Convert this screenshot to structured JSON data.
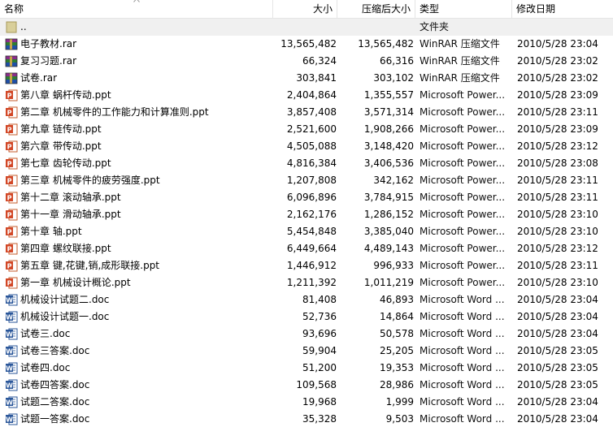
{
  "columns": {
    "name": "名称",
    "size": "大小",
    "packed": "压缩后大小",
    "type": "类型",
    "modified": "修改日期"
  },
  "parent": {
    "name": "..",
    "type": "文件夹"
  },
  "files": [
    {
      "name": "电子教材.rar",
      "size": "13,565,482",
      "packed": "13,565,482",
      "type": "WinRAR 压缩文件",
      "modified": "2010/5/28 23:04",
      "icon": "rar-archive-icon"
    },
    {
      "name": "复习习题.rar",
      "size": "66,324",
      "packed": "66,316",
      "type": "WinRAR 压缩文件",
      "modified": "2010/5/28 23:02",
      "icon": "rar-archive-icon"
    },
    {
      "name": "试卷.rar",
      "size": "303,841",
      "packed": "303,102",
      "type": "WinRAR 压缩文件",
      "modified": "2010/5/28 23:02",
      "icon": "rar-archive-icon"
    },
    {
      "name": "第八章 蜗杆传动.ppt",
      "size": "2,404,864",
      "packed": "1,355,557",
      "type": "Microsoft Power...",
      "modified": "2010/5/28 23:09",
      "icon": "powerpoint-file-icon"
    },
    {
      "name": "第二章 机械零件的工作能力和计算准则.ppt",
      "size": "3,857,408",
      "packed": "3,571,314",
      "type": "Microsoft Power...",
      "modified": "2010/5/28 23:11",
      "icon": "powerpoint-file-icon"
    },
    {
      "name": "第九章 链传动.ppt",
      "size": "2,521,600",
      "packed": "1,908,266",
      "type": "Microsoft Power...",
      "modified": "2010/5/28 23:09",
      "icon": "powerpoint-file-icon"
    },
    {
      "name": "第六章 带传动.ppt",
      "size": "4,505,088",
      "packed": "3,148,420",
      "type": "Microsoft Power...",
      "modified": "2010/5/28 23:12",
      "icon": "powerpoint-file-icon"
    },
    {
      "name": "第七章 齿轮传动.ppt",
      "size": "4,816,384",
      "packed": "3,406,536",
      "type": "Microsoft Power...",
      "modified": "2010/5/28 23:08",
      "icon": "powerpoint-file-icon"
    },
    {
      "name": "第三章 机械零件的疲劳强度.ppt",
      "size": "1,207,808",
      "packed": "342,162",
      "type": "Microsoft Power...",
      "modified": "2010/5/28 23:11",
      "icon": "powerpoint-file-icon"
    },
    {
      "name": "第十二章 滚动轴承.ppt",
      "size": "6,096,896",
      "packed": "3,784,915",
      "type": "Microsoft Power...",
      "modified": "2010/5/28 23:11",
      "icon": "powerpoint-file-icon"
    },
    {
      "name": "第十一章 滑动轴承.ppt",
      "size": "2,162,176",
      "packed": "1,286,152",
      "type": "Microsoft Power...",
      "modified": "2010/5/28 23:10",
      "icon": "powerpoint-file-icon"
    },
    {
      "name": "第十章 轴.ppt",
      "size": "5,454,848",
      "packed": "3,385,040",
      "type": "Microsoft Power...",
      "modified": "2010/5/28 23:10",
      "icon": "powerpoint-file-icon"
    },
    {
      "name": "第四章 螺纹联接.ppt",
      "size": "6,449,664",
      "packed": "4,489,143",
      "type": "Microsoft Power...",
      "modified": "2010/5/28 23:12",
      "icon": "powerpoint-file-icon"
    },
    {
      "name": "第五章 键,花键,销,成形联接.ppt",
      "size": "1,446,912",
      "packed": "996,933",
      "type": "Microsoft Power...",
      "modified": "2010/5/28 23:11",
      "icon": "powerpoint-file-icon"
    },
    {
      "name": "第一章 机械设计概论.ppt",
      "size": "1,211,392",
      "packed": "1,011,219",
      "type": "Microsoft Power...",
      "modified": "2010/5/28 23:10",
      "icon": "powerpoint-file-icon"
    },
    {
      "name": "机械设计试题二.doc",
      "size": "81,408",
      "packed": "46,893",
      "type": "Microsoft Word ...",
      "modified": "2010/5/28 23:04",
      "icon": "word-file-icon"
    },
    {
      "name": "机械设计试题一.doc",
      "size": "52,736",
      "packed": "14,864",
      "type": "Microsoft Word ...",
      "modified": "2010/5/28 23:04",
      "icon": "word-file-icon"
    },
    {
      "name": "试卷三.doc",
      "size": "93,696",
      "packed": "50,578",
      "type": "Microsoft Word ...",
      "modified": "2010/5/28 23:04",
      "icon": "word-file-icon"
    },
    {
      "name": "试卷三答案.doc",
      "size": "59,904",
      "packed": "25,205",
      "type": "Microsoft Word ...",
      "modified": "2010/5/28 23:05",
      "icon": "word-file-icon"
    },
    {
      "name": "试卷四.doc",
      "size": "51,200",
      "packed": "19,353",
      "type": "Microsoft Word ...",
      "modified": "2010/5/28 23:05",
      "icon": "word-file-icon"
    },
    {
      "name": "试卷四答案.doc",
      "size": "109,568",
      "packed": "28,986",
      "type": "Microsoft Word ...",
      "modified": "2010/5/28 23:05",
      "icon": "word-file-icon"
    },
    {
      "name": "试题二答案.doc",
      "size": "19,968",
      "packed": "1,999",
      "type": "Microsoft Word ...",
      "modified": "2010/5/28 23:04",
      "icon": "word-file-icon"
    },
    {
      "name": "试题一答案.doc",
      "size": "35,328",
      "packed": "9,503",
      "type": "Microsoft Word ...",
      "modified": "2010/5/28 23:04",
      "icon": "word-file-icon"
    }
  ]
}
